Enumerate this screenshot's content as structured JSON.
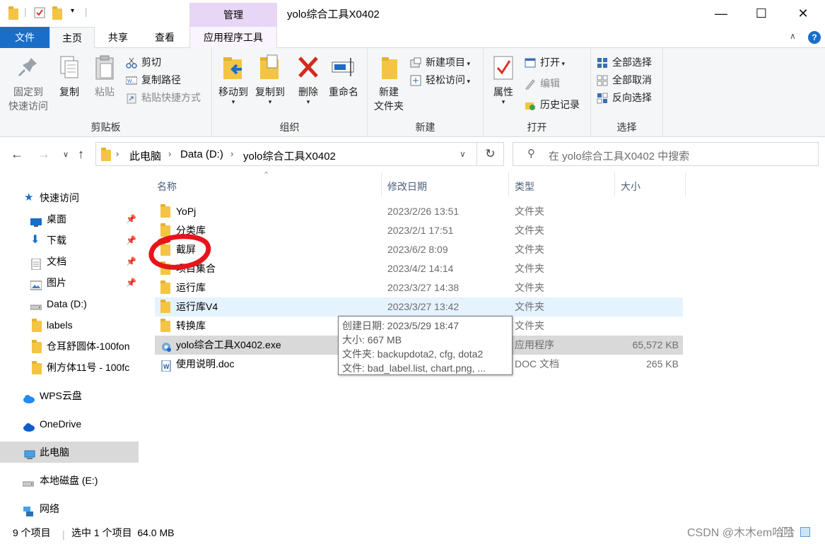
{
  "window": {
    "title": "yolo综合工具X0402",
    "manage_tab": "管理",
    "min_glyph": "—",
    "max_glyph": "☐",
    "close_glyph": "✕"
  },
  "tabs": {
    "file": "文件",
    "home": "主页",
    "share": "共享",
    "view": "查看",
    "app_tools": "应用程序工具"
  },
  "ribbon": {
    "clipboard": {
      "label": "剪贴板",
      "pin_line1": "固定到",
      "pin_line2": "快速访问",
      "copy": "复制",
      "paste": "粘贴",
      "cut": "剪切",
      "copy_path": "复制路径",
      "paste_shortcut": "粘贴快捷方式"
    },
    "organize": {
      "label": "组织",
      "move_to": "移动到",
      "copy_to": "复制到",
      "delete": "删除",
      "rename": "重命名"
    },
    "new": {
      "label": "新建",
      "new_folder_line1": "新建",
      "new_folder_line2": "文件夹",
      "new_item": "新建项目",
      "easy_access": "轻松访问"
    },
    "open": {
      "label": "打开",
      "properties": "属性",
      "open": "打开",
      "edit": "编辑",
      "history": "历史记录"
    },
    "select": {
      "label": "选择",
      "select_all": "全部选择",
      "select_none": "全部取消",
      "invert": "反向选择"
    }
  },
  "address": {
    "crumbs": [
      "此电脑",
      "Data (D:)",
      "yolo综合工具X0402"
    ],
    "search_placeholder": "在 yolo综合工具X0402 中搜索"
  },
  "nav": {
    "quick_access": "快速访问",
    "items": [
      "桌面",
      "下载",
      "文档",
      "图片",
      "Data (D:)",
      "labels",
      "仓耳舒圆体-100fon",
      "俐方体11号 - 100fc"
    ],
    "wps": "WPS云盘",
    "onedrive": "OneDrive",
    "this_pc": "此电脑",
    "local_disk": "本地磁盘 (E:)",
    "network": "网络"
  },
  "columns": {
    "name": "名称",
    "date": "修改日期",
    "type": "类型",
    "size": "大小"
  },
  "files": [
    {
      "name": "YoPj",
      "date": "2023/2/26 13:51",
      "type": "文件夹",
      "size": ""
    },
    {
      "name": "分类库",
      "date": "2023/2/1 17:51",
      "type": "文件夹",
      "size": ""
    },
    {
      "name": "截屏",
      "date": "2023/6/2 8:09",
      "type": "文件夹",
      "size": ""
    },
    {
      "name": "项目集合",
      "date": "2023/4/2 14:14",
      "type": "文件夹",
      "size": ""
    },
    {
      "name": "运行库",
      "date": "2023/3/27 14:38",
      "type": "文件夹",
      "size": ""
    },
    {
      "name": "运行库V4",
      "date": "2023/3/27 13:42",
      "type": "文件夹",
      "size": ""
    },
    {
      "name": "转换库",
      "date": "",
      "type": "文件夹",
      "size": ""
    },
    {
      "name": "yolo综合工具X0402.exe",
      "date": "",
      "type": "应用程序",
      "size": "65,572 KB"
    },
    {
      "name": "使用说明.doc",
      "date": "",
      "type": "DOC 文档",
      "size": "265 KB"
    }
  ],
  "tooltip": {
    "line1": "创建日期: 2023/5/29 18:47",
    "line2": "大小: 667 MB",
    "line3": "文件夹: backupdota2, cfg, dota2",
    "line4": "文件: bad_label.list, chart.png, ..."
  },
  "status": {
    "count": "9 个项目",
    "selected": "选中 1 个项目  64.0 MB"
  },
  "watermark": "CSDN @木木em哈哈",
  "colors": {
    "accent": "#1a6ec8",
    "manage_tab": "#e7d6f5",
    "folder": "#f4c542",
    "hover_row": "#e5f3ff",
    "annotation": "#e8141b"
  }
}
